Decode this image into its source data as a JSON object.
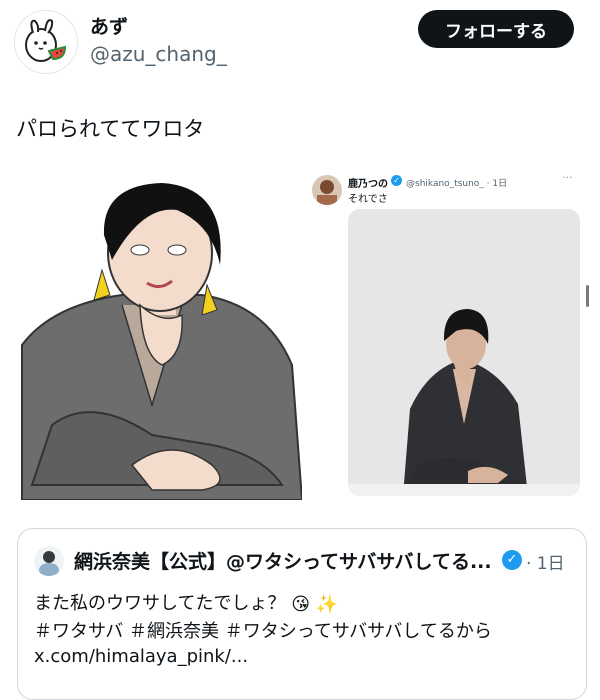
{
  "author": {
    "display_name": "あず",
    "handle": "@azu_chang_",
    "avatar_icon": "watermelon-bunny-avatar-icon"
  },
  "follow_button": {
    "label": "フォローする"
  },
  "tweet": {
    "text": "パロられててワロタ"
  },
  "embedded_post": {
    "display_name": "鹿乃つの",
    "handle_time": "@shikano_tsuno_ · 1日",
    "text": "それでさ",
    "more_label": "···"
  },
  "quoted_post": {
    "display_name": "網浜奈美【公式】@ワタシってサバサバしてる...",
    "verified_icon": "verified-badge-icon",
    "time": "· 1日",
    "line1": "また私のウワサしてたでしょ？",
    "line1_emojis": [
      "😘",
      "✨"
    ],
    "hashtags": "＃ワタサバ ＃網浜奈美 ＃ワタシってサバサバしてるから",
    "link": "x.com/himalaya_pink/..."
  },
  "colors": {
    "text": "#0f1419",
    "secondary": "#536471",
    "verified": "#1d9bf0",
    "button_bg": "#0f1419",
    "border": "#cfd9de"
  }
}
